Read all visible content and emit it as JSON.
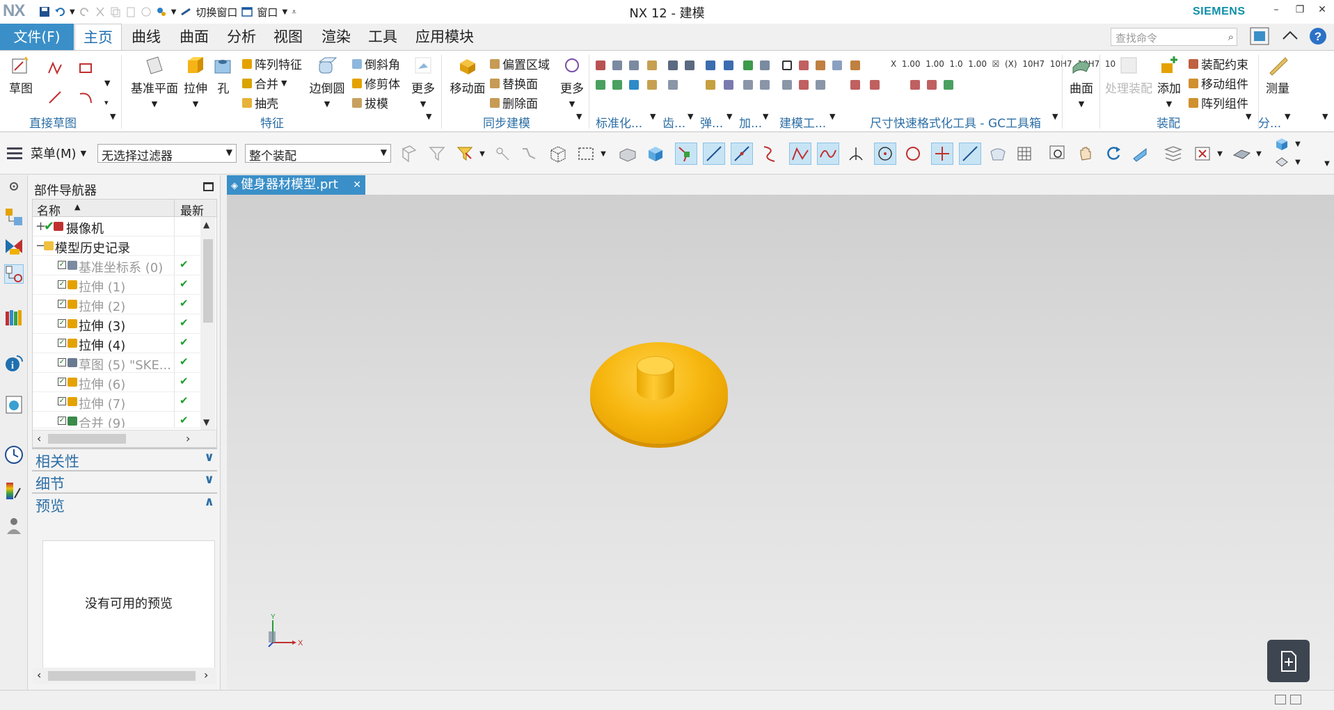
{
  "app": {
    "logo": "NX",
    "title": "NX 12 - 建模",
    "brand": "SIEMENS",
    "quick_access": {
      "switch_window": "切换窗口",
      "window": "窗口"
    }
  },
  "menu": {
    "file": "文件(F)",
    "tabs": [
      "主页",
      "曲线",
      "曲面",
      "分析",
      "视图",
      "渲染",
      "工具",
      "应用模块"
    ],
    "active_tab": "主页",
    "search_placeholder": "查找命令"
  },
  "ribbon": {
    "sketch": {
      "label": "草图",
      "group": "直接草图"
    },
    "feature": {
      "datum_plane": "基准平面",
      "extrude": "拉伸",
      "hole": "孔",
      "pattern_feature": "阵列特征",
      "unite": "合并",
      "shell": "抽壳",
      "edge_blend": "边倒圆",
      "chamfer": "倒斜角",
      "trim_body": "修剪体",
      "draft": "拔模",
      "more": "更多",
      "group": "特征"
    },
    "sync": {
      "move_face": "移动面",
      "offset_region": "偏置区域",
      "replace_face": "替换面",
      "delete_face": "删除面",
      "more": "更多",
      "group": "同步建模"
    },
    "groups_misc": [
      "标准化...",
      "齿...",
      "弹...",
      "加...",
      "建模工...",
      "尺寸快速格式化工具 - GC工具箱"
    ],
    "surface": {
      "label": "曲面"
    },
    "assembly": {
      "process_assembly": "处理装配",
      "add": "添加",
      "assembly_constraint": "装配约束",
      "move_component": "移动组件",
      "pattern_component": "阵列组件",
      "group": "装配"
    },
    "measure": {
      "label": "测量",
      "group": "分..."
    }
  },
  "toolbar2": {
    "menu": "菜单(M)",
    "filter": "无选择过滤器",
    "scope": "整个装配"
  },
  "navigator": {
    "title": "部件导航器",
    "col_name": "名称",
    "col_latest": "最新",
    "rows": [
      {
        "label": "摄像机",
        "dim": false,
        "latest": ""
      },
      {
        "label": "模型历史记录",
        "dim": false,
        "latest": ""
      },
      {
        "label": "基准坐标系 (0)",
        "dim": true,
        "latest": "✔"
      },
      {
        "label": "拉伸 (1)",
        "dim": true,
        "latest": "✔"
      },
      {
        "label": "拉伸 (2)",
        "dim": true,
        "latest": "✔"
      },
      {
        "label": "拉伸 (3)",
        "dim": false,
        "latest": "✔"
      },
      {
        "label": "拉伸 (4)",
        "dim": false,
        "latest": "✔"
      },
      {
        "label": "草图 (5) \"SKE...",
        "dim": true,
        "latest": "✔"
      },
      {
        "label": "拉伸 (6)",
        "dim": true,
        "latest": "✔"
      },
      {
        "label": "拉伸 (7)",
        "dim": true,
        "latest": "✔"
      },
      {
        "label": "合并 (9)",
        "dim": true,
        "latest": "✔"
      }
    ],
    "sections": {
      "dependencies": "相关性",
      "details": "细节",
      "preview": "预览"
    },
    "preview_empty": "没有可用的预览"
  },
  "document": {
    "tab": "健身器材模型.prt"
  },
  "triad": {
    "x": "X",
    "y": "Y"
  },
  "colors": {
    "accent": "#3a8fc8",
    "part": "#f7b710",
    "siemens": "#0e8fa8",
    "check": "#1e9e2e"
  },
  "icons": [
    "save-icon",
    "undo-icon",
    "redo-icon",
    "search-icon",
    "help-icon",
    "close-icon",
    "checkmark-icon",
    "folder-icon",
    "extrude-icon",
    "camera-icon",
    "new-document-icon"
  ]
}
